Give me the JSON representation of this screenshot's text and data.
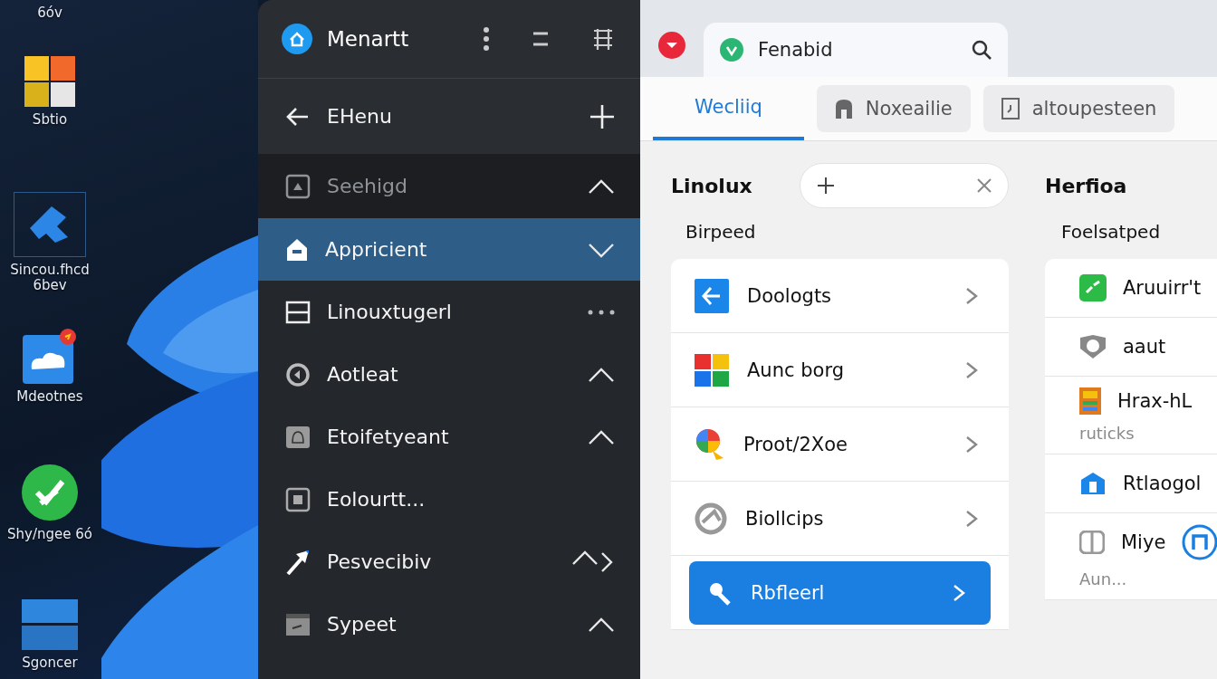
{
  "desktop": {
    "icons": [
      {
        "label": "6óv",
        "kind": "cut"
      },
      {
        "label": "Sbtio",
        "kind": "tiles"
      },
      {
        "label": "Sincou.fhcd 6bev",
        "kind": "pin"
      },
      {
        "label": "Mdeotnes",
        "kind": "cloud"
      },
      {
        "label": "Shy/ngee 6ó",
        "kind": "check"
      },
      {
        "label": "Sgoncer",
        "kind": "window"
      }
    ]
  },
  "menu": {
    "title": "Menartt",
    "subheader": "EHenu",
    "items": [
      {
        "label": "Seehigd",
        "kind": "up",
        "selected": false,
        "disabled": true
      },
      {
        "label": "Appricient",
        "kind": "down",
        "selected": true,
        "disabled": false
      },
      {
        "label": "Linouxtugerl",
        "kind": "more",
        "selected": false,
        "disabled": false
      },
      {
        "label": "Aotleat",
        "kind": "up",
        "selected": false,
        "disabled": false
      },
      {
        "label": "Etoifetyeant",
        "kind": "up",
        "selected": false,
        "disabled": false
      },
      {
        "label": "Eolourtt...",
        "kind": "none",
        "selected": false,
        "disabled": false
      },
      {
        "label": "Pesvecibiv",
        "kind": "up-right",
        "selected": false,
        "disabled": false
      },
      {
        "label": "Sypeet",
        "kind": "up",
        "selected": false,
        "disabled": false
      }
    ]
  },
  "browser": {
    "tab": {
      "label": "Fenabid"
    },
    "nav_tabs": [
      {
        "label": "Wecliiq",
        "selected": true
      },
      {
        "label": "Noxeailie",
        "selected": false
      },
      {
        "label": "altoupesteen",
        "selected": false
      }
    ],
    "left": {
      "heading": "Linolux",
      "subtitle": "Birpeed",
      "items": [
        {
          "label": "Doologts",
          "selected": false
        },
        {
          "label": "Aunc borg",
          "selected": false
        },
        {
          "label": "Proot/2Xoe",
          "selected": false
        },
        {
          "label": "Biollcips",
          "selected": false
        },
        {
          "label": "Rbfleerl",
          "selected": true
        }
      ]
    },
    "right": {
      "heading": "Herfioa",
      "subtitle": "Foelsatped",
      "items": [
        {
          "label": "Aruuirr't",
          "kind": "plain"
        },
        {
          "label": "aaut",
          "kind": "plain"
        },
        {
          "label": "Hrax-hL",
          "note": "ruticks",
          "kind": "plain"
        },
        {
          "label": "Rtlaogol",
          "kind": "plain"
        },
        {
          "label": "Miye",
          "note": "Aun...",
          "kind": "badge"
        }
      ]
    }
  }
}
